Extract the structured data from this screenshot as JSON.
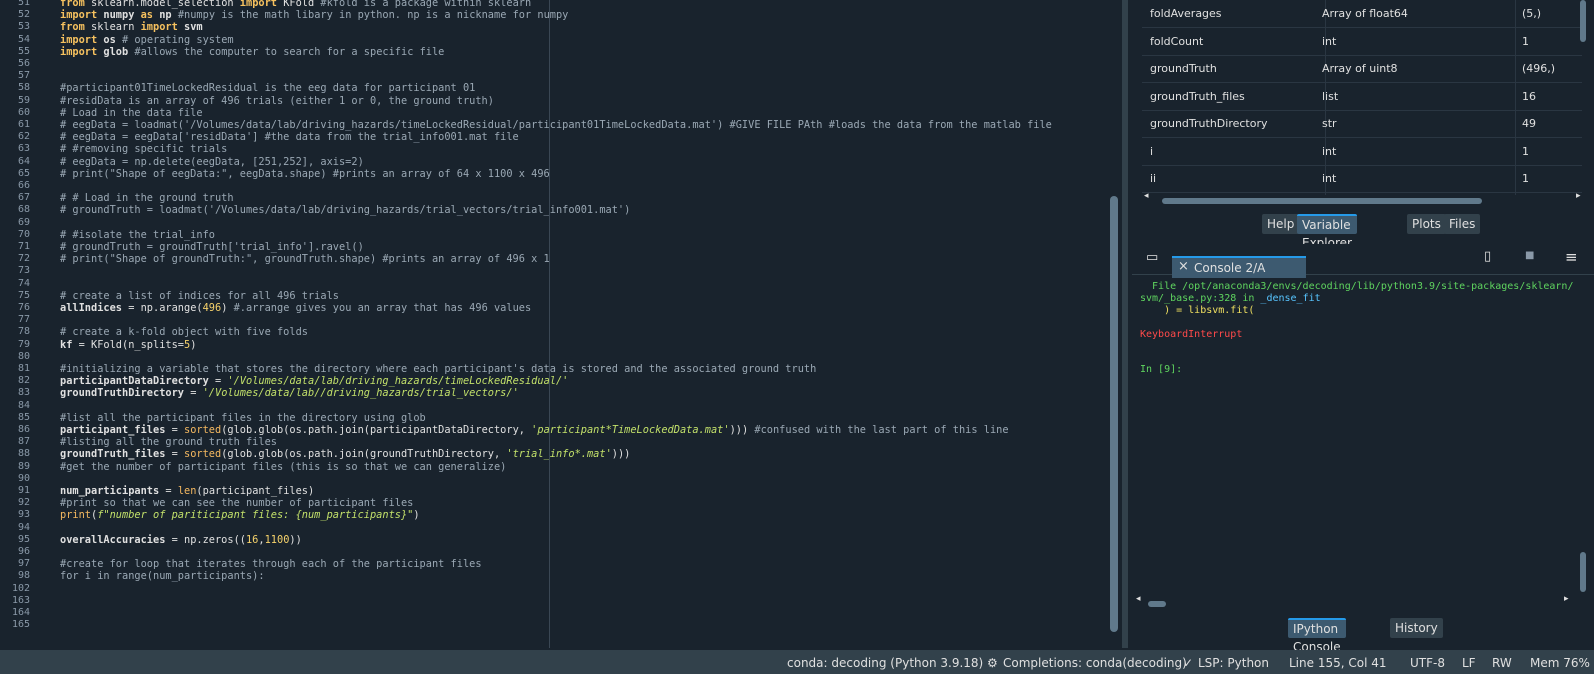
{
  "editor": {
    "lines": [
      {
        "n": "51",
        "html": "<span class='kw'>from</span> sklearn.model_selection <span class='kw'>import</span> KFold <span class='cm'>#kfold is a package within sklearn</span>"
      },
      {
        "n": "52",
        "html": "<span class='kw'>import</span> <span class='kw2'>numpy</span> <span class='kw'>as</span> <span class='kw2'>np</span> <span class='cm'>#numpy is the math libary in python. np is a nickname for numpy</span>"
      },
      {
        "n": "53",
        "html": "<span class='kw'>from</span> sklearn <span class='kw'>import</span> <span class='kw2'>svm</span>"
      },
      {
        "n": "54",
        "html": "<span class='kw'>import</span> <span class='kw2'>os</span> <span class='cm'># operating system</span>"
      },
      {
        "n": "55",
        "html": "<span class='kw'>import</span> <span class='kw2'>glob</span> <span class='cm'>#allows the computer to search for a specific file</span>"
      },
      {
        "n": "56",
        "html": ""
      },
      {
        "n": "57",
        "html": ""
      },
      {
        "n": "58",
        "html": "<span class='cm'>#participant01TimeLockedResidual is the eeg data for participant 01</span>"
      },
      {
        "n": "59",
        "html": "<span class='cm'>#residData is an array of 496 trials (either 1 or 0, the ground truth)</span>"
      },
      {
        "n": "60",
        "html": "<span class='cm'># Load in the data file</span>"
      },
      {
        "n": "61",
        "html": "<span class='cm'># eegData = loadmat('/Volumes/data/lab/driving_hazards/timeLockedResidual/participant01TimeLockedData.mat') #GIVE FILE PAth #loads the data from the matlab file</span>"
      },
      {
        "n": "62",
        "html": "<span class='cm'># eegData = eegData['residData'] #the data from the trial_info001.mat file</span>"
      },
      {
        "n": "63",
        "html": "<span class='cm'># #removing specific trials</span>"
      },
      {
        "n": "64",
        "html": "<span class='cm'># eegData = np.delete(eegData, [251,252], axis=2)</span>"
      },
      {
        "n": "65",
        "html": "<span class='cm'># print(\"Shape of eegData:\", eegData.shape) #prints an array of 64 x 1100 x 496</span>"
      },
      {
        "n": "66",
        "html": ""
      },
      {
        "n": "67",
        "html": "<span class='cm'># # Load in the ground truth</span>"
      },
      {
        "n": "68",
        "html": "<span class='cm'># groundTruth = loadmat('/Volumes/data/lab/driving_hazards/trial_vectors/trial_info001.mat')</span>"
      },
      {
        "n": "69",
        "html": ""
      },
      {
        "n": "70",
        "html": "<span class='cm'># #isolate the trial_info</span>"
      },
      {
        "n": "71",
        "html": "<span class='cm'># groundTruth = groundTruth['trial_info'].ravel()</span>"
      },
      {
        "n": "72",
        "html": "<span class='cm'># print(\"Shape of groundTruth:\", groundTruth.shape) #prints an array of 496 x 1</span>"
      },
      {
        "n": "73",
        "html": ""
      },
      {
        "n": "74",
        "html": ""
      },
      {
        "n": "75",
        "html": "<span class='cm'># create a list of indices for all 496 trials</span>"
      },
      {
        "n": "76",
        "html": "<span class='kw2'>allIndices</span> = np.arange(<span class='num'>496</span>) <span class='cm'>#.arrange gives you an array that has 496 values</span>"
      },
      {
        "n": "77",
        "html": ""
      },
      {
        "n": "78",
        "html": "<span class='cm'># create a k-fold object with five folds</span>"
      },
      {
        "n": "79",
        "html": "<span class='kw2'>kf</span> = KFold(n_splits=<span class='num'>5</span>)"
      },
      {
        "n": "80",
        "html": ""
      },
      {
        "n": "81",
        "html": "<span class='cm'>#initializing a variable that stores the directory where each participant's data is stored and the associated ground truth</span>"
      },
      {
        "n": "82",
        "html": "<span class='kw2'>participantDataDirectory</span> = <span class='str'>'/Volumes/data/lab/driving_hazards/timeLockedResidual/'</span>"
      },
      {
        "n": "83",
        "html": "<span class='kw2'>groundTruthDirectory</span> = <span class='str'>'/Volumes/data/lab//driving_hazards/trial_vectors/'</span>"
      },
      {
        "n": "84",
        "html": ""
      },
      {
        "n": "85",
        "html": "<span class='cm'>#list all the participant files in the directory using glob</span>"
      },
      {
        "n": "86",
        "html": "<span class='kw2'>participant_files</span> = <span class='fn'>sorted</span>(glob.glob(os.path.join(participantDataDirectory, <span class='str'>'participant*TimeLockedData.mat'</span>))) <span class='cm'>#confused with the last part of this line</span>"
      },
      {
        "n": "87",
        "html": "<span class='cm'>#listing all the ground truth files</span>"
      },
      {
        "n": "88",
        "html": "<span class='kw2'>groundTruth_files</span> = <span class='fn'>sorted</span>(glob.glob(os.path.join(groundTruthDirectory, <span class='str'>'trial_info*.mat'</span>)))"
      },
      {
        "n": "89",
        "html": "<span class='cm'>#get the number of participant files (this is so that we can generalize)</span>"
      },
      {
        "n": "90",
        "html": ""
      },
      {
        "n": "91",
        "html": "<span class='kw2'>num_participants</span> = <span class='fn'>len</span>(participant_files)"
      },
      {
        "n": "92",
        "html": "<span class='cm'>#print so that we can see the number of participant files</span>"
      },
      {
        "n": "93",
        "html": "<span class='fn'>print</span>(<span class='str'>f\"number of pariticipant files: {num_participants}\"</span>)"
      },
      {
        "n": "94",
        "html": ""
      },
      {
        "n": "95",
        "html": "<span class='kw2'>overallAccuracies</span> = np.zeros((<span class='num'>16</span>,<span class='num'>1100</span>))"
      },
      {
        "n": "96",
        "html": ""
      },
      {
        "n": "97",
        "html": "<span class='cm'>#create for loop that iterates through each of the participant files</span>"
      },
      {
        "n": "98",
        "html": "<span class='cm'>for i in range(num_participants):</span>"
      },
      {
        "n": "102",
        "html": ""
      },
      {
        "n": "163",
        "html": ""
      },
      {
        "n": "164",
        "html": ""
      },
      {
        "n": "165",
        "html": ""
      }
    ]
  },
  "variable_explorer": {
    "rows": [
      {
        "name": "foldAverages",
        "type": "Array of float64",
        "size": "(5,)"
      },
      {
        "name": "foldCount",
        "type": "int",
        "size": "1"
      },
      {
        "name": "groundTruth",
        "type": "Array of uint8",
        "size": "(496,)"
      },
      {
        "name": "groundTruth_files",
        "type": "list",
        "size": "16"
      },
      {
        "name": "groundTruthDirectory",
        "type": "str",
        "size": "49"
      },
      {
        "name": "i",
        "type": "int",
        "size": "1"
      },
      {
        "name": "ii",
        "type": "int",
        "size": "1"
      }
    ]
  },
  "top_tabs": {
    "help": "Help",
    "variable_explorer": "Variable Explorer",
    "plots": "Plots",
    "files": "Files"
  },
  "console": {
    "tab_label": "Console 2/A",
    "line1": "  File /opt/anaconda3/envs/decoding/lib/python3.9/site-packages/sklearn/",
    "line2_a": "svm/_base.py:328",
    "line2_b": " in ",
    "line2_c": "_dense_fit",
    "line3": "    ) = libsvm.fit(",
    "error": "KeyboardInterrupt",
    "prompt": "In [9]:"
  },
  "bottom_tabs": {
    "ipython": "IPython Console",
    "history": "History"
  },
  "status": {
    "env": "conda: decoding (Python 3.9.18)",
    "completions": "Completions: conda(decoding)",
    "lsp": "LSP: Python",
    "pos": "Line 155, Col 41",
    "enc": "UTF-8",
    "eol": "LF",
    "rw": "RW",
    "mem": "Mem 76%"
  },
  "icons": {
    "close": "×",
    "window": "▭",
    "copy": "▯",
    "stop": "■",
    "menu": "≡",
    "check": "✓"
  }
}
